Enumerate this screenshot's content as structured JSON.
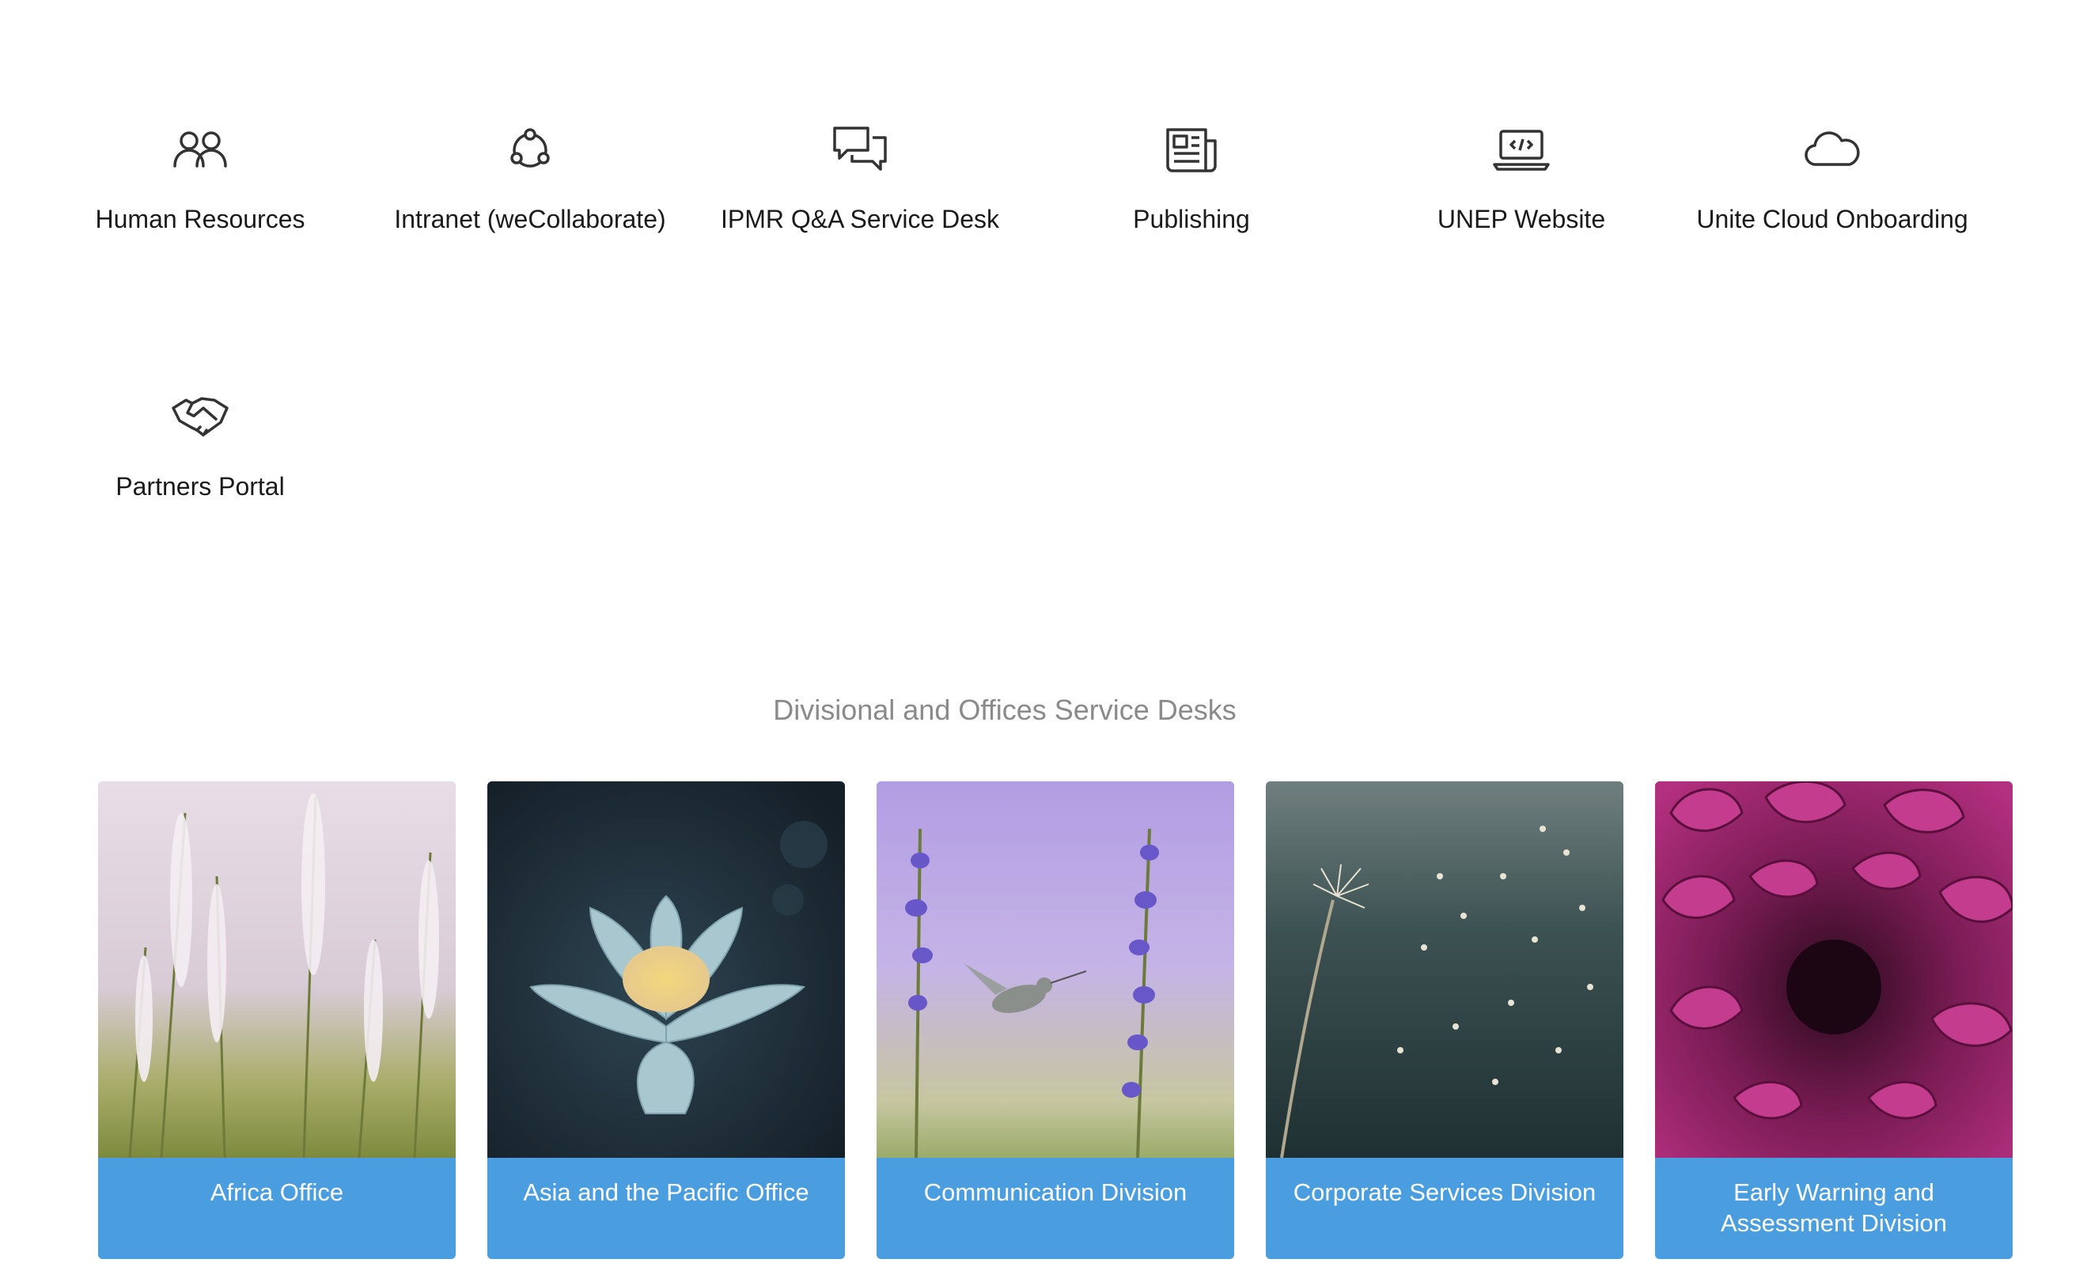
{
  "services": [
    {
      "label": "Human Resources",
      "icon": "users-icon"
    },
    {
      "label": "Intranet (weCollaborate)",
      "icon": "network-icon"
    },
    {
      "label": "IPMR Q&A Service Desk",
      "icon": "chat-bubbles-icon"
    },
    {
      "label": "Publishing",
      "icon": "newspaper-icon"
    },
    {
      "label": "UNEP Website",
      "icon": "laptop-code-icon"
    },
    {
      "label": "Unite Cloud Onboarding",
      "icon": "cloud-icon"
    },
    {
      "label": "Partners Portal",
      "icon": "handshake-icon"
    }
  ],
  "divisions": {
    "title": "Divisional and Offices Service Desks",
    "cards": [
      {
        "label": "Africa Office"
      },
      {
        "label": "Asia and the Pacific Office"
      },
      {
        "label": "Communication Division"
      },
      {
        "label": "Corporate Services Division"
      },
      {
        "label": "Early Warning and Assessment Division"
      }
    ]
  },
  "colors": {
    "card_caption": "#4a9ee0",
    "section_title": "#8a8a8a"
  }
}
